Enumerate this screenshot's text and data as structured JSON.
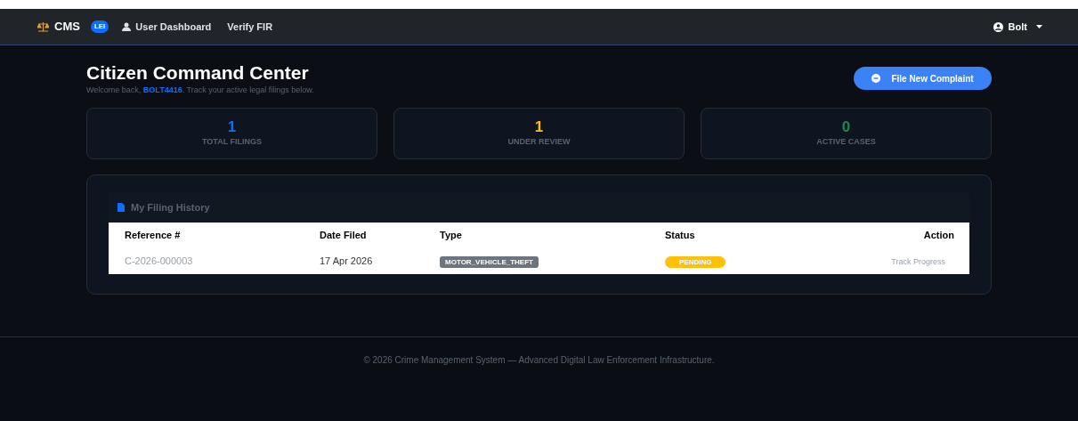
{
  "navbar": {
    "brand": "CMS",
    "badge": "LEI",
    "links": [
      {
        "label": "User Dashboard"
      },
      {
        "label": "Verify FIR"
      }
    ],
    "user": "Bolt"
  },
  "header": {
    "title": "Citizen Command Center",
    "welcome_prefix": "Welcome back,",
    "username": "BOLT4416",
    "welcome_suffix": ". Track your active legal filings below.",
    "button": "File New Complaint"
  },
  "stats": [
    {
      "value": "1",
      "label": "TOTAL FILINGS",
      "color": "#0d6efd"
    },
    {
      "value": "1",
      "label": "UNDER REVIEW",
      "color": "#ffc107"
    },
    {
      "value": "0",
      "label": "ACTIVE CASES",
      "color": "#198754"
    }
  ],
  "filing_history": {
    "title": "My Filing History",
    "columns": [
      "Reference #",
      "Date Filed",
      "Type",
      "Status",
      "Action"
    ],
    "rows": [
      {
        "reference": "C-2026-000003",
        "date": "17 Apr 2026",
        "type": "MOTOR_VEHICLE_THEFT",
        "status": "PENDING",
        "action": "Track Progress"
      }
    ]
  },
  "footer": "© 2026 Crime Management System — Advanced Digital Law Enforcement Infrastructure."
}
